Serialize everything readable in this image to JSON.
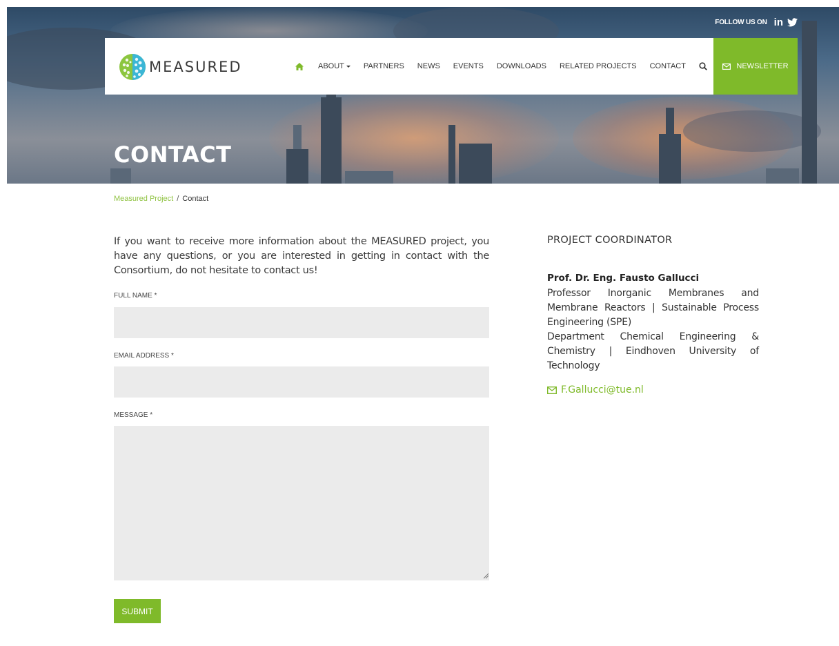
{
  "header": {
    "follow_label": "FOLLOW US ON",
    "linkedin_label": "in",
    "logo_text": "MEASURED",
    "nav": {
      "about": "ABOUT",
      "partners": "PARTNERS",
      "news": "NEWS",
      "events": "EVENTS",
      "downloads": "DOWNLOADS",
      "related": "RELATED PROJECTS",
      "contact": "CONTACT"
    },
    "newsletter_label": "NEWSLETTER",
    "page_title": "CONTACT"
  },
  "breadcrumb": {
    "home": "Measured Project",
    "separator": "/",
    "current": "Contact"
  },
  "form": {
    "intro": "If you want to receive more information about the MEASURED project, you have any questions, or you are interested in getting in contact with the Consortium, do not hesitate to contact us!",
    "full_name_label": "FULL NAME *",
    "full_name_value": "",
    "email_label": "EMAIL ADDRESS *",
    "email_value": "",
    "message_label": "MESSAGE *",
    "message_value": "",
    "submit_label": "SUBMIT"
  },
  "coordinator": {
    "heading": "PROJECT COORDINATOR",
    "name": "Prof. Dr. Eng. Fausto Gallucci",
    "line1": "Professor Inorganic Membranes and Membrane Reactors | Sustainable Process Engineering (SPE)",
    "line2": "Department Chemical Engineering & Chemistry | Eindhoven University of Technology",
    "email": "F.Gallucci@tue.nl"
  },
  "colors": {
    "accent": "#7fba2a",
    "field_bg": "#ebebeb"
  },
  "icons": [
    "home-icon",
    "search-icon",
    "envelope-icon",
    "linkedin-icon",
    "twitter-icon",
    "resize-handle-icon"
  ]
}
